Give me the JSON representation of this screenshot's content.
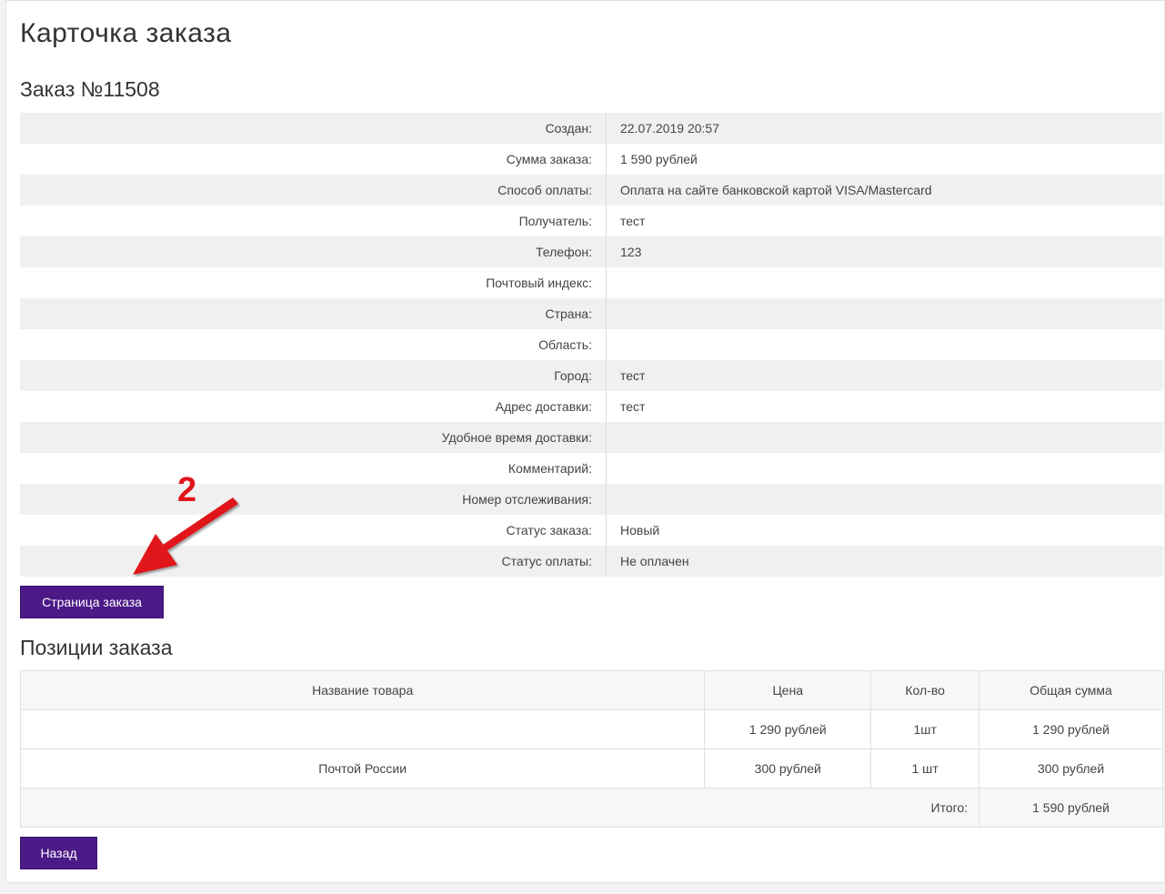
{
  "page_title": "Карточка заказа",
  "order_title": "Заказ №11508",
  "details": [
    {
      "label": "Создан:",
      "value": "22.07.2019 20:57"
    },
    {
      "label": "Сумма заказа:",
      "value": "1 590 рублей"
    },
    {
      "label": "Способ оплаты:",
      "value": "Оплата на сайте банковской картой VISA/Mastercard"
    },
    {
      "label": "Получатель:",
      "value": "тест"
    },
    {
      "label": "Телефон:",
      "value": "123"
    },
    {
      "label": "Почтовый индекс:",
      "value": ""
    },
    {
      "label": "Страна:",
      "value": ""
    },
    {
      "label": "Область:",
      "value": ""
    },
    {
      "label": "Город:",
      "value": "тест"
    },
    {
      "label": "Адрес доставки:",
      "value": "тест"
    },
    {
      "label": "Удобное время доставки:",
      "value": ""
    },
    {
      "label": "Комментарий:",
      "value": ""
    },
    {
      "label": "Номер отслеживания:",
      "value": ""
    },
    {
      "label": "Статус заказа:",
      "value": "Новый"
    },
    {
      "label": "Статус оплаты:",
      "value": "Не оплачен"
    }
  ],
  "order_page_button": "Страница заказа",
  "items_title": "Позиции заказа",
  "items_table": {
    "headers": [
      "Название товара",
      "Цена",
      "Кол-во",
      "Общая сумма"
    ],
    "rows": [
      {
        "name": "",
        "price": "1 290 рублей",
        "qty": "1шт",
        "sum": "1 290 рублей"
      },
      {
        "name": "Почтой России",
        "price": "300 рублей",
        "qty": "1 шт",
        "sum": "300 рублей"
      }
    ],
    "total_label": "Итого:",
    "total_value": "1 590 рублей"
  },
  "back_button": "Назад",
  "annotation": {
    "number": "2",
    "color": "#e0161a"
  },
  "colors": {
    "button": "#4b1a87",
    "row_alt": "#f0f0f1"
  }
}
